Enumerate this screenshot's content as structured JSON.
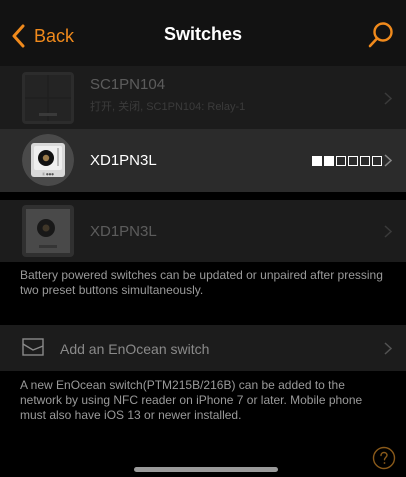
{
  "nav": {
    "back_label": "Back",
    "title": "Switches",
    "accent_color": "#f08a1c"
  },
  "devices": [
    {
      "name": "SC1PN104",
      "subtitle": "打开, 关闭, SC1PN104: Relay-1",
      "state": "dimmed"
    },
    {
      "name": "XD1PN3L",
      "subtitle": "",
      "state": "active",
      "signal_level": 2,
      "signal_max": 6
    },
    {
      "name": "XD1PN3L",
      "subtitle": "",
      "state": "dimmed"
    }
  ],
  "battery_note": "Battery powered switches can be updated or unpaired after pressing two preset buttons simultaneously.",
  "add_switch": {
    "label": "Add an EnOcean switch",
    "icon": "switch-plate-icon"
  },
  "nfc_note": "A new EnOcean switch(PTM215B/216B) can be added to the network by using NFC reader on iPhone 7 or later. Mobile phone must also have iOS 13 or newer installed.",
  "help_icon": "question-icon"
}
